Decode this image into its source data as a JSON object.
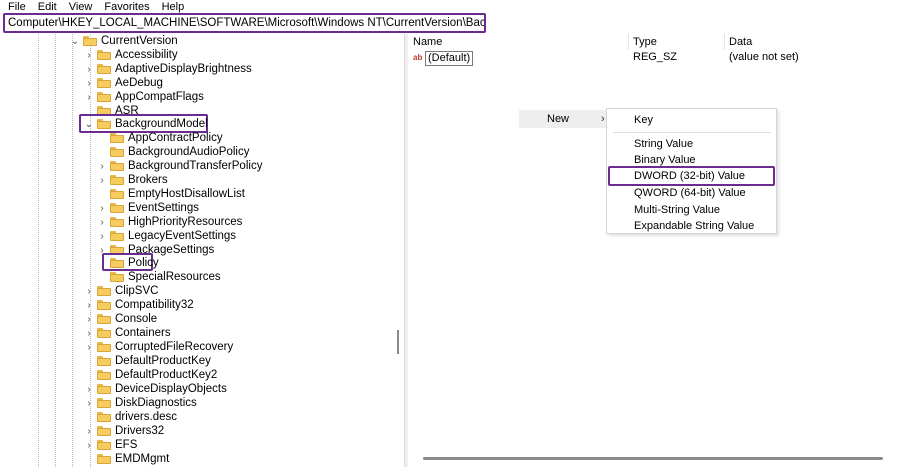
{
  "menu": [
    "File",
    "Edit",
    "View",
    "Favorites",
    "Help"
  ],
  "address": "Computer\\HKEY_LOCAL_MACHINE\\SOFTWARE\\Microsoft\\Windows NT\\CurrentVersion\\BackgroundModel\\Policy",
  "tree": {
    "root": "CurrentVersion",
    "level1_before": [
      "Accessibility",
      "AdaptiveDisplayBrightness",
      "AeDebug",
      "AppCompatFlags",
      "ASR"
    ],
    "selected_parent": "BackgroundModel",
    "children": [
      "AppContractPolicy",
      "BackgroundAudioPolicy",
      "BackgroundTransferPolicy",
      "Brokers",
      "EmptyHostDisallowList",
      "EventSettings",
      "HighPriorityResources",
      "LegacyEventSettings",
      "PackageSettings",
      "Policy",
      "SpecialResources"
    ],
    "level1_after": [
      "ClipSVC",
      "Compatibility32",
      "Console",
      "Containers",
      "CorruptedFileRecovery",
      "DefaultProductKey",
      "DefaultProductKey2",
      "DeviceDisplayObjects",
      "DiskDiagnostics",
      "drivers.desc",
      "Drivers32",
      "EFS",
      "EMDMgmt"
    ]
  },
  "list": {
    "headers": {
      "name": "Name",
      "type": "Type",
      "data": "Data"
    },
    "rows": [
      {
        "icon": "ab",
        "name": "(Default)",
        "type": "REG_SZ",
        "data": "(value not set)"
      }
    ]
  },
  "context_menu": {
    "new_label": "New",
    "arrow": "›",
    "items": [
      "Key",
      "String Value",
      "Binary Value",
      "DWORD (32-bit) Value",
      "QWORD (64-bit) Value",
      "Multi-String Value",
      "Expandable String Value"
    ]
  },
  "highlight_color": "#6a2c91"
}
